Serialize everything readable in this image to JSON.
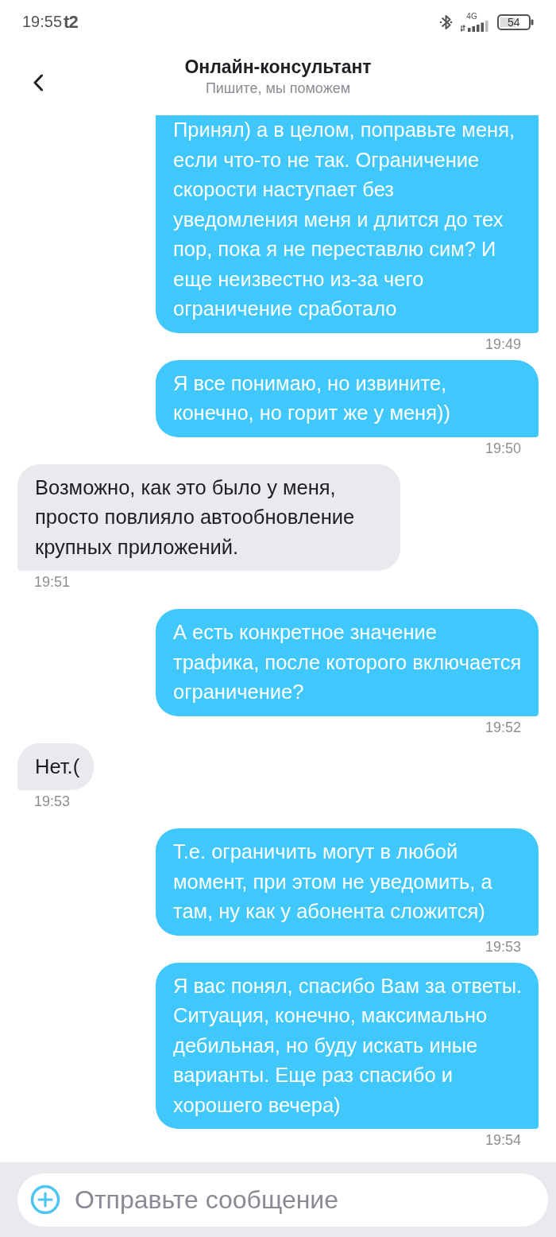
{
  "status_bar": {
    "time": "19:55",
    "carrier": "t2",
    "network": "4G",
    "battery": "54"
  },
  "header": {
    "title": "Онлайн-консультант",
    "subtitle": "Пишите, мы поможем"
  },
  "messages": [
    {
      "kind": "outgoing",
      "text": "Принял) а в целом, поправьте меня, если что-то не так. Ограничение скорости наступает без уведомления меня и длится до тех пор, пока я не переставлю сим? И еще неизвестно из-за чего ограничение сработало",
      "time": "19:49"
    },
    {
      "kind": "outgoing",
      "text": "Я все понимаю, но извините, конечно, но горит же у меня))",
      "time": "19:50"
    },
    {
      "kind": "incoming",
      "text": "Возможно, как это было у меня, просто повлияло автообновление крупных приложений.",
      "time": "19:51"
    },
    {
      "kind": "outgoing",
      "text": "А есть конкретное значение трафика, после которого включается ограничение?",
      "time": "19:52"
    },
    {
      "kind": "incoming",
      "text": "Нет.(",
      "time": "19:53"
    },
    {
      "kind": "outgoing",
      "text": "Т.е. ограничить могут в любой момент, при этом не уведомить, а там, ну как у абонента сложится)",
      "time": "19:53"
    },
    {
      "kind": "outgoing",
      "text": "Я вас понял, спасибо Вам за ответы. Ситуация, конечно, максимально дебильная, но буду искать иные варианты. Еще раз спасибо и хорошего вечера)",
      "time": "19:54"
    }
  ],
  "composer": {
    "placeholder": "Отправьте сообщение"
  }
}
